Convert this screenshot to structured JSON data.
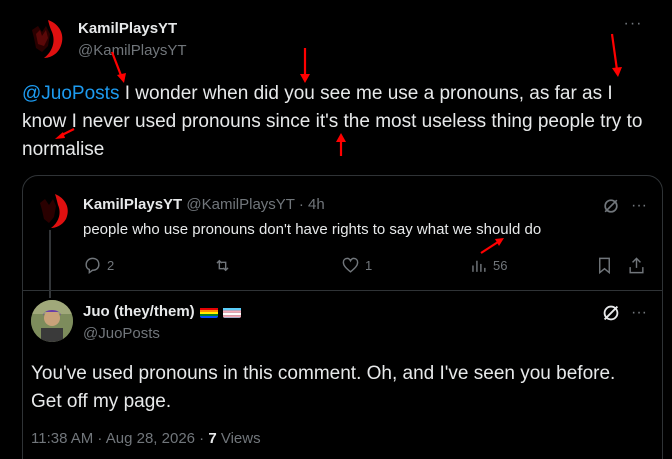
{
  "main_post": {
    "author_name": "KamilPlaysYT",
    "author_handle": "@KamilPlaysYT",
    "more_label": "···",
    "mention": "@JuoPosts",
    "text": " I wonder when did you see me use a pronouns, as far as I know I never used pronouns since it's the most useless thing people try to normalise"
  },
  "quoted_post": {
    "author_name": "KamilPlaysYT",
    "meta": "@KamilPlaysYT · 4h",
    "text": "people who use pronouns don't have rights to say what we should do",
    "more_label": "···",
    "actions": {
      "replies": "2",
      "likes": "1",
      "views": "56"
    }
  },
  "reply_post": {
    "author_name": "Juo (they/them)",
    "author_handle": "@JuoPosts",
    "more_label": "···",
    "text": "You've used pronouns in this comment. Oh, and I've seen you before. Get off my page.",
    "timestamp": "11:38 AM · Aug 28, 2026 · ",
    "views_count": "7",
    "views_label": " Views"
  },
  "colors": {
    "background": "#000000",
    "text": "#e7e9ea",
    "secondary": "#71767b",
    "accent": "#1d9bf0",
    "border": "#2f3336",
    "annotation_arrow": "#ff0000"
  }
}
